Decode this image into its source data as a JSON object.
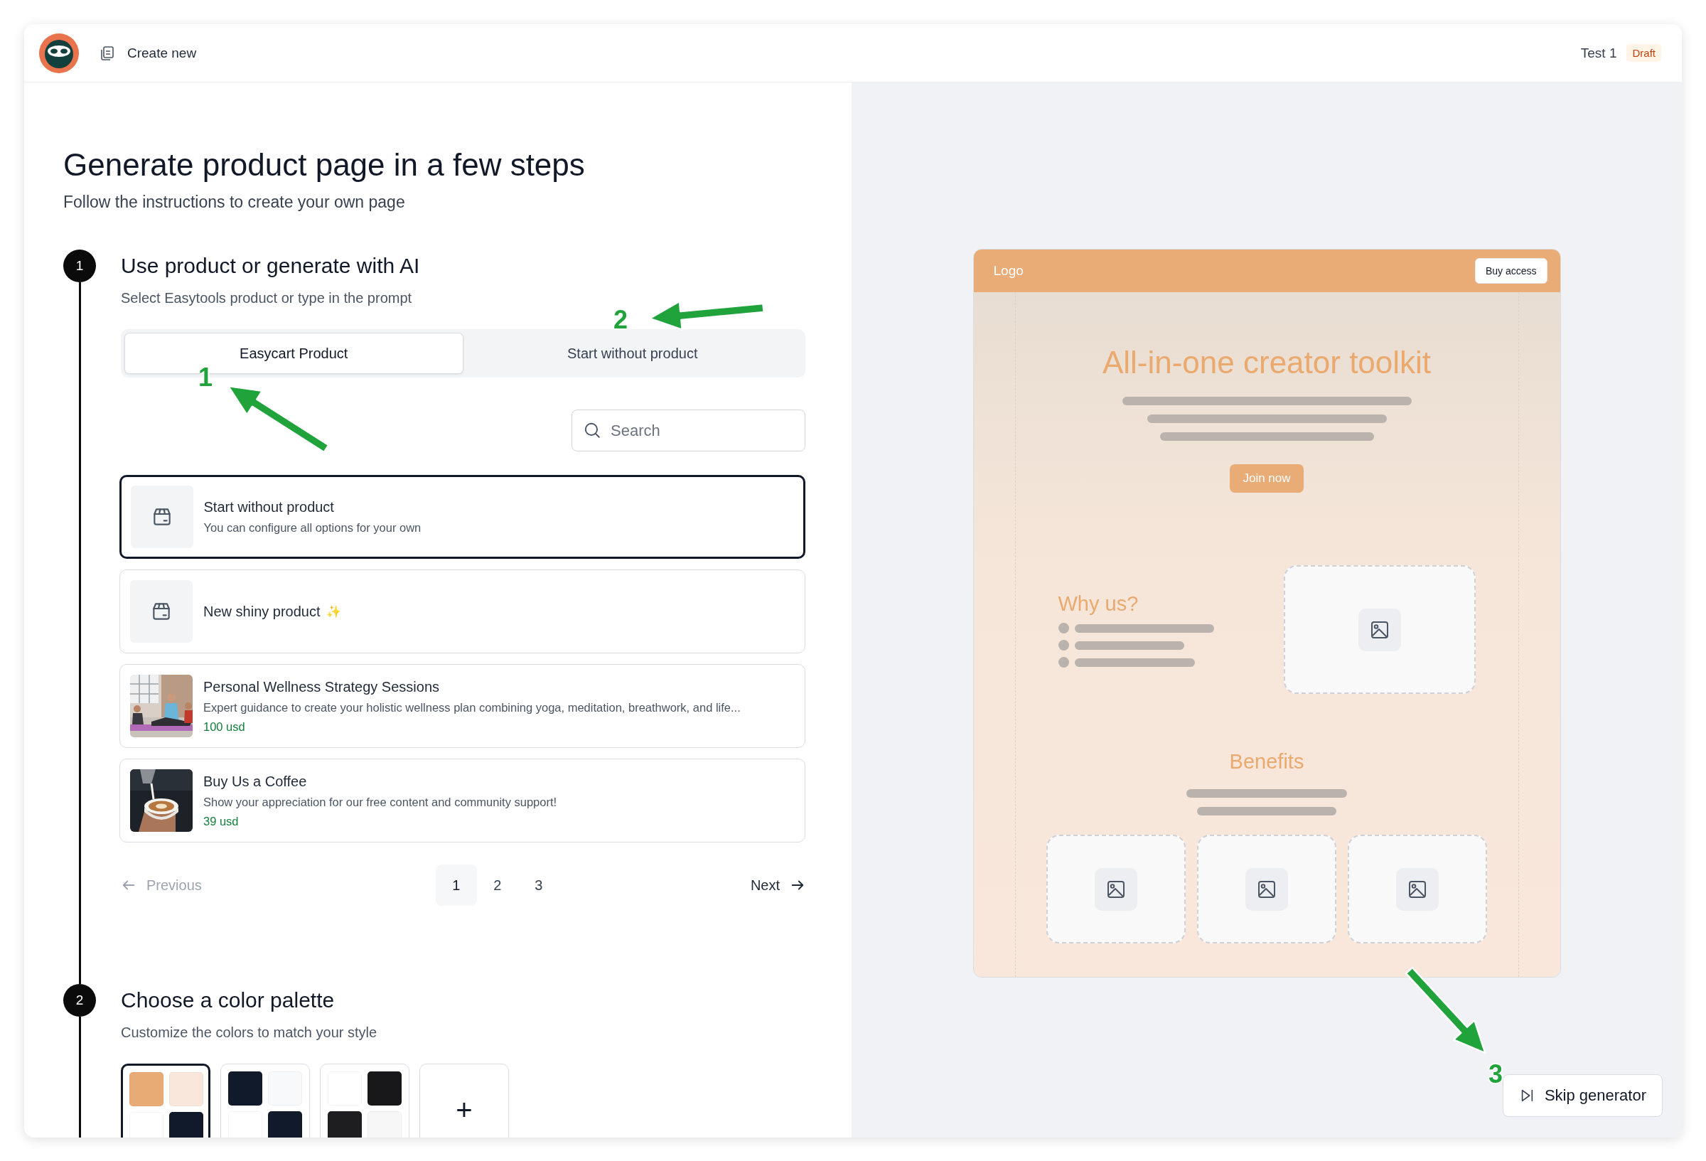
{
  "header": {
    "create_label": "Create new",
    "page_name": "Test 1",
    "status": "Draft"
  },
  "intro": {
    "title": "Generate product page in a few steps",
    "subtitle": "Follow the instructions to create your own page"
  },
  "steps": [
    {
      "number": "1",
      "title": "Use product or generate with AI",
      "subtitle": "Select Easytools product or type in the prompt"
    },
    {
      "number": "2",
      "title": "Choose a color palette",
      "subtitle": "Customize the colors to match your style"
    }
  ],
  "tabs": [
    {
      "label": "Easycart Product",
      "selected": true
    },
    {
      "label": "Start without product",
      "selected": false
    }
  ],
  "search": {
    "placeholder": "Search"
  },
  "products": [
    {
      "kind": "placeholder",
      "title": "Start without product",
      "description": "You can configure all options for your own",
      "selected": true
    },
    {
      "kind": "placeholder",
      "title": "New shiny product",
      "sparkle": "✨",
      "selected": false
    },
    {
      "title": "Personal Wellness Strategy Sessions",
      "description": "Expert guidance to create your holistic wellness plan combining yoga, meditation, breathwork, and life...",
      "price": "100 usd",
      "selected": false
    },
    {
      "title": "Buy Us a Coffee",
      "description": "Show your appreciation for our free content and community support!",
      "price": "39 usd",
      "selected": false
    }
  ],
  "pagination": {
    "previous": {
      "label": "Previous",
      "disabled": true
    },
    "pages": [
      {
        "label": "1",
        "selected": true
      },
      {
        "label": "2",
        "selected": false
      },
      {
        "label": "3",
        "selected": false
      }
    ],
    "next": {
      "label": "Next",
      "disabled": false
    }
  },
  "palettes": [
    {
      "selected": true,
      "swatches": [
        {
          "color": "#e8ab76"
        },
        {
          "color": "#f8e7da"
        },
        {
          "color": "#ffffff"
        },
        {
          "color": "#111a2b"
        }
      ]
    },
    {
      "selected": false,
      "swatches": [
        {
          "color": "#111a2b"
        },
        {
          "color": "#f8f9fb"
        },
        {
          "color": "#ffffff"
        },
        {
          "color": "#111a2b"
        }
      ]
    },
    {
      "selected": false,
      "swatches": [
        {
          "color": "#ffffff"
        },
        {
          "color": "#18181a"
        },
        {
          "color": "#1e1e20"
        },
        {
          "color": "#f7f7f8"
        }
      ]
    }
  ],
  "add_palette": "+",
  "preview": {
    "logo": "Logo",
    "button": "Buy access",
    "hero_title": "All-in-one creator toolkit",
    "cta": "Join now",
    "why_title": "Why us?",
    "benefits_title": "Benefits"
  },
  "skip_button": "Skip generator",
  "annotations": [
    {
      "label": "1"
    },
    {
      "label": "2"
    },
    {
      "label": "3"
    }
  ]
}
